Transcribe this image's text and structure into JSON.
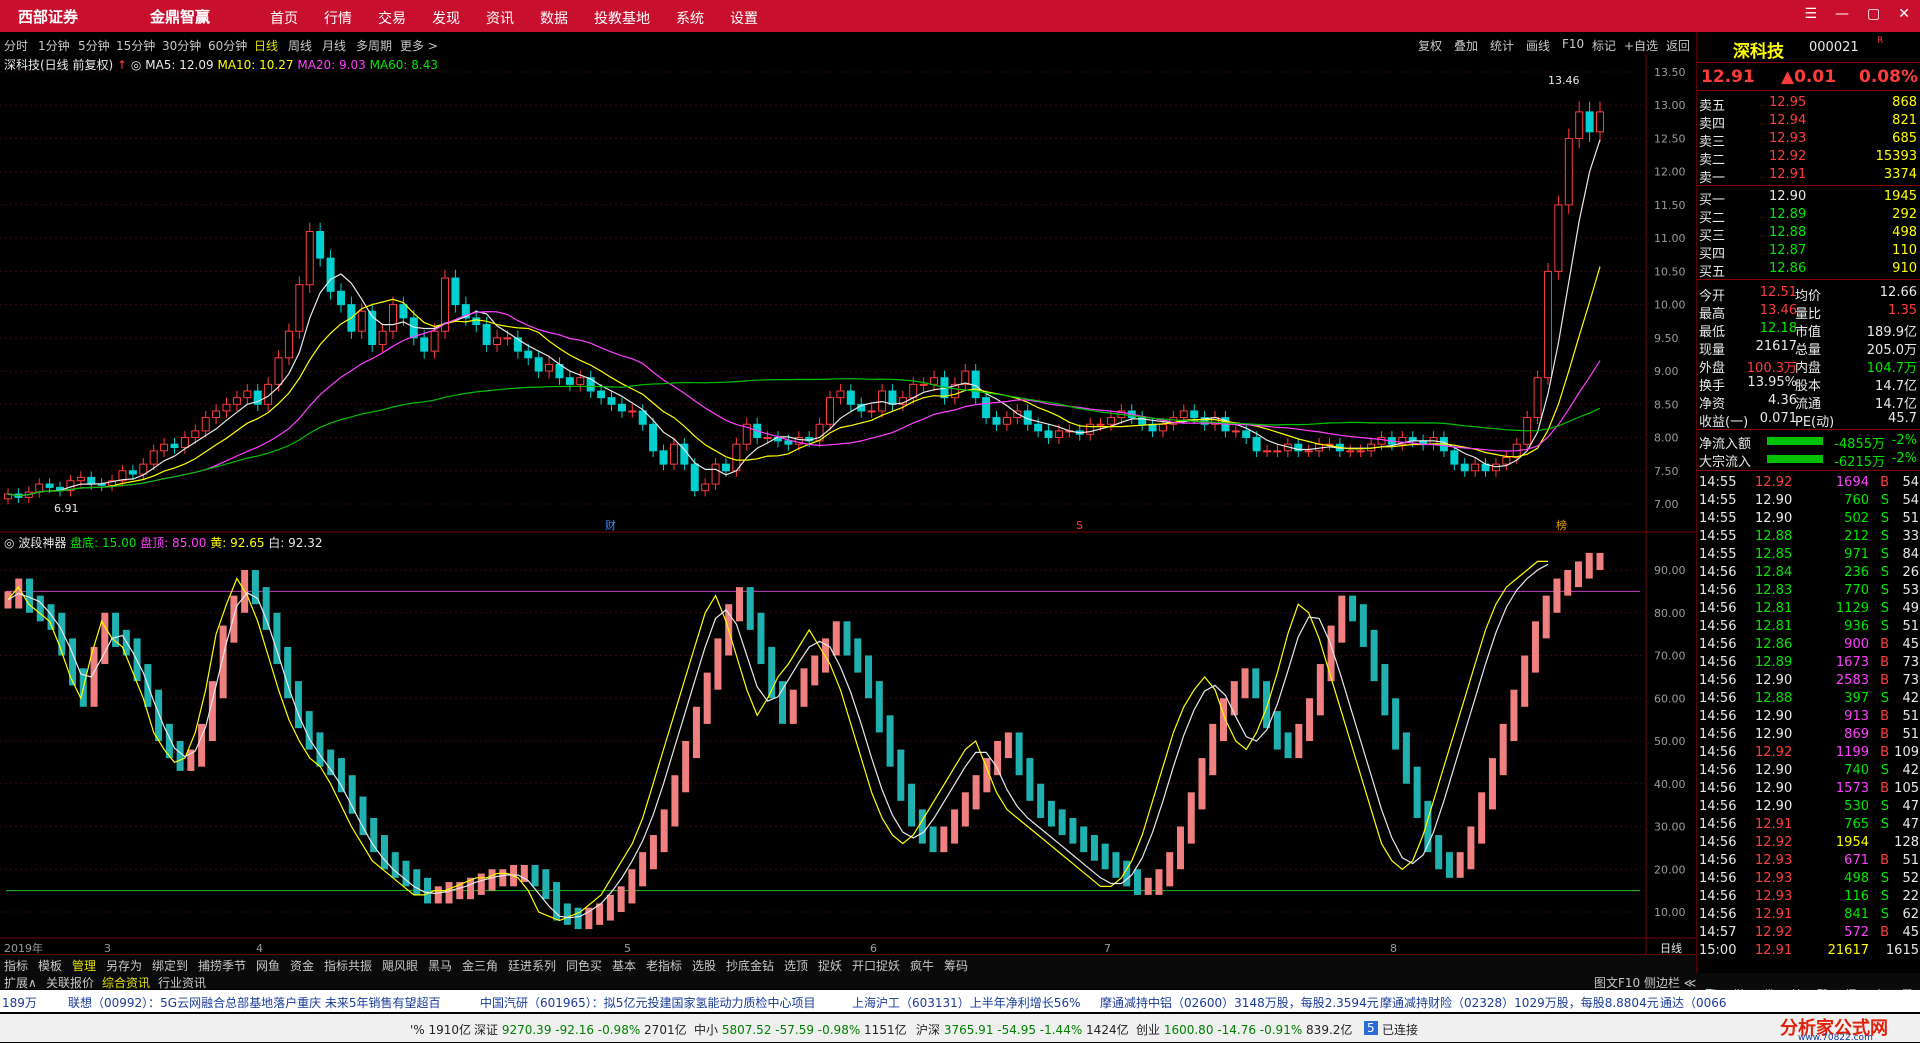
{
  "topbar": {
    "broker": "西部证券",
    "brand": "金鼎智赢",
    "menu": [
      "首页",
      "行情",
      "交易",
      "发现",
      "资讯",
      "数据",
      "投教基地",
      "系统",
      "设置"
    ],
    "window_controls": [
      "☰",
      "—",
      "▢",
      "✕"
    ]
  },
  "periods": {
    "items": [
      "分时",
      "1分钟",
      "5分钟",
      "15分钟",
      "30分钟",
      "60分钟",
      "日线",
      "周线",
      "月线",
      "多周期",
      "更多 >"
    ],
    "active": "日线",
    "right_tools": [
      "复权",
      "叠加",
      "统计",
      "画线",
      "F10",
      "标记",
      "+自选",
      "返回"
    ]
  },
  "main_chart": {
    "stock_label": "深科技(日线 前复权)",
    "ma5": "MA5: 12.09",
    "ma10": "MA10: 10.27",
    "ma20": "MA20: 9.03",
    "ma60": "MA60: 8.43",
    "max_label": "13.46",
    "min_label": "6.91",
    "markers": [
      "财",
      "S",
      "榜"
    ]
  },
  "indicator": {
    "name": "波段神器",
    "bottom": "盘底: 15.00",
    "top": "盘顶: 85.00",
    "yellow": "黄: 92.65",
    "white": "白: 92.32"
  },
  "chart_data": {
    "type": "candlestick",
    "price_axis_ticks": [
      "13.50",
      "13.00",
      "12.50",
      "12.00",
      "11.50",
      "11.00",
      "10.50",
      "10.00",
      "9.50",
      "9.00",
      "8.50",
      "8.00",
      "7.50",
      "7.00"
    ],
    "indicator_axis_ticks": [
      "90.00",
      "80.00",
      "70.00",
      "60.00",
      "50.00",
      "40.00",
      "30.00",
      "20.00",
      "10.00"
    ],
    "time_labels": [
      "2019年",
      "3",
      "4",
      "5",
      "6",
      "7",
      "8"
    ],
    "period_label": "日线",
    "closes": [
      7.15,
      7.1,
      7.18,
      7.3,
      7.25,
      7.2,
      7.35,
      7.4,
      7.3,
      7.28,
      7.35,
      7.5,
      7.45,
      7.6,
      7.8,
      7.9,
      7.85,
      8.0,
      8.1,
      8.3,
      8.4,
      8.5,
      8.6,
      8.7,
      8.5,
      8.8,
      9.2,
      9.6,
      10.3,
      11.1,
      10.7,
      10.2,
      10.0,
      9.6,
      9.9,
      9.4,
      9.6,
      10.0,
      9.8,
      9.5,
      9.3,
      9.6,
      10.4,
      10.0,
      9.8,
      9.7,
      9.4,
      9.5,
      9.5,
      9.3,
      9.2,
      9.0,
      9.1,
      8.9,
      8.8,
      8.9,
      8.7,
      8.6,
      8.5,
      8.4,
      8.4,
      8.2,
      7.8,
      7.6,
      7.9,
      7.6,
      7.2,
      7.3,
      7.6,
      7.5,
      7.9,
      8.2,
      8.0,
      8.0,
      7.95,
      7.9,
      8.0,
      7.95,
      8.2,
      8.6,
      8.7,
      8.5,
      8.4,
      8.4,
      8.7,
      8.5,
      8.6,
      8.8,
      8.8,
      8.9,
      8.6,
      8.8,
      9.0,
      8.6,
      8.3,
      8.2,
      8.3,
      8.4,
      8.2,
      8.1,
      8.0,
      8.1,
      8.1,
      8.05,
      8.2,
      8.2,
      8.3,
      8.4,
      8.3,
      8.2,
      8.1,
      8.2,
      8.3,
      8.4,
      8.3,
      8.2,
      8.3,
      8.1,
      8.1,
      8.0,
      7.8,
      7.8,
      7.8,
      7.9,
      7.8,
      7.8,
      7.9,
      7.9,
      7.8,
      7.8,
      7.8,
      7.9,
      8.0,
      7.9,
      8.0,
      7.95,
      7.9,
      8.0,
      7.8,
      7.6,
      7.5,
      7.6,
      7.5,
      7.6,
      7.7,
      7.9,
      8.3,
      8.9,
      10.5,
      11.5,
      12.5,
      12.9,
      12.6,
      12.9
    ],
    "indicator_values": [
      83,
      86,
      82,
      80,
      78,
      72,
      65,
      60,
      70,
      78,
      74,
      72,
      66,
      60,
      52,
      48,
      45,
      46,
      52,
      62,
      75,
      82,
      88,
      84,
      78,
      70,
      62,
      55,
      50,
      46,
      44,
      40,
      35,
      30,
      26,
      22,
      20,
      18,
      16,
      14,
      14,
      15,
      15,
      16,
      17,
      18,
      18,
      19,
      19,
      18,
      15,
      10,
      9,
      8,
      9,
      10,
      12,
      14,
      18,
      22,
      26,
      32,
      40,
      48,
      56,
      64,
      72,
      80,
      84,
      78,
      70,
      62,
      56,
      60,
      65,
      68,
      72,
      76,
      72,
      68,
      62,
      54,
      46,
      38,
      32,
      28,
      26,
      28,
      32,
      36,
      40,
      44,
      48,
      50,
      44,
      38,
      34,
      32,
      30,
      28,
      26,
      24,
      22,
      20,
      18,
      16,
      16,
      18,
      22,
      28,
      36,
      44,
      52,
      58,
      62,
      65,
      62,
      55,
      50,
      48,
      52,
      58,
      66,
      75,
      82,
      80,
      74,
      66,
      58,
      50,
      42,
      34,
      26,
      22,
      20,
      22,
      28,
      36,
      44,
      52,
      60,
      68,
      76,
      82,
      86,
      88,
      90,
      92,
      92
    ]
  },
  "quote": {
    "name": "深科技",
    "code": "000021",
    "rz": "R",
    "price": "12.91",
    "change": "▲0.01",
    "pct": "0.08%",
    "asks": [
      [
        "卖五",
        "12.95",
        "868"
      ],
      [
        "卖四",
        "12.94",
        "821"
      ],
      [
        "卖三",
        "12.93",
        "685"
      ],
      [
        "卖二",
        "12.92",
        "15393"
      ],
      [
        "卖一",
        "12.91",
        "3374"
      ]
    ],
    "bids": [
      [
        "买一",
        "12.90",
        "1945"
      ],
      [
        "买二",
        "12.89",
        "292"
      ],
      [
        "买三",
        "12.88",
        "498"
      ],
      [
        "买四",
        "12.87",
        "110"
      ],
      [
        "买五",
        "12.86",
        "910"
      ]
    ],
    "stats": [
      [
        "今开",
        "12.51",
        "均价",
        "12.66"
      ],
      [
        "最高",
        "13.46",
        "量比",
        "1.35"
      ],
      [
        "最低",
        "12.18",
        "市值",
        "189.9亿"
      ],
      [
        "现量",
        "21617",
        "总量",
        "205.0万"
      ],
      [
        "外盘",
        "100.3万",
        "内盘",
        "104.7万"
      ],
      [
        "换手",
        "13.95%",
        "股本",
        "14.7亿"
      ],
      [
        "净资",
        "4.36",
        "流通",
        "14.7亿"
      ],
      [
        "收益(一)",
        "0.071",
        "PE(动)",
        "45.7"
      ]
    ],
    "flows": [
      [
        "净流入额",
        "-4855万",
        "-2%"
      ],
      [
        "大宗流入",
        "-6215万",
        "-2%"
      ]
    ],
    "ticks": [
      [
        "14:55",
        "12.92",
        "1694",
        "B",
        "54"
      ],
      [
        "14:55",
        "12.90",
        "760",
        "S",
        "54"
      ],
      [
        "14:55",
        "12.90",
        "502",
        "S",
        "51"
      ],
      [
        "14:55",
        "12.88",
        "212",
        "S",
        "33"
      ],
      [
        "14:55",
        "12.85",
        "971",
        "S",
        "84"
      ],
      [
        "14:56",
        "12.84",
        "236",
        "S",
        "26"
      ],
      [
        "14:56",
        "12.83",
        "770",
        "S",
        "53"
      ],
      [
        "14:56",
        "12.81",
        "1129",
        "S",
        "49"
      ],
      [
        "14:56",
        "12.81",
        "936",
        "S",
        "51"
      ],
      [
        "14:56",
        "12.86",
        "900",
        "B",
        "45"
      ],
      [
        "14:56",
        "12.89",
        "1673",
        "B",
        "73"
      ],
      [
        "14:56",
        "12.90",
        "2583",
        "B",
        "73"
      ],
      [
        "14:56",
        "12.88",
        "397",
        "S",
        "42"
      ],
      [
        "14:56",
        "12.90",
        "913",
        "B",
        "51"
      ],
      [
        "14:56",
        "12.90",
        "869",
        "B",
        "51"
      ],
      [
        "14:56",
        "12.92",
        "1199",
        "B",
        "109"
      ],
      [
        "14:56",
        "12.90",
        "740",
        "S",
        "42"
      ],
      [
        "14:56",
        "12.90",
        "1573",
        "B",
        "105"
      ],
      [
        "14:56",
        "12.90",
        "530",
        "S",
        "47"
      ],
      [
        "14:56",
        "12.91",
        "765",
        "S",
        "47"
      ],
      [
        "14:56",
        "12.92",
        "1954",
        "",
        "128"
      ],
      [
        "14:56",
        "12.93",
        "671",
        "B",
        "51"
      ],
      [
        "14:56",
        "12.93",
        "498",
        "S",
        "52"
      ],
      [
        "14:56",
        "12.93",
        "116",
        "S",
        "22"
      ],
      [
        "14:56",
        "12.91",
        "841",
        "S",
        "62"
      ],
      [
        "14:57",
        "12.92",
        "572",
        "B",
        "45"
      ],
      [
        "15:00",
        "12.91",
        "21617",
        "",
        "1615"
      ]
    ],
    "side_tabs": [
      "笔",
      "价",
      "细",
      "势",
      "联",
      "值",
      "主",
      "筹"
    ]
  },
  "bottom_tabs": [
    "指标",
    "模板",
    "管理",
    "另存为",
    "绑定到",
    "捕捞季节",
    "网鱼",
    "资金",
    "指标共振",
    "飓风眼",
    "黑马",
    "金三角",
    "廷进系列",
    "同色买",
    "基本",
    "老指标",
    "选股",
    "抄底金钻",
    "选顶",
    "捉妖",
    "开口捉妖",
    "疯牛",
    "筹码"
  ],
  "bottom_tabs_active": "管理",
  "sub_tabs": [
    "扩展∧",
    "关联报价",
    "综合资讯",
    "行业资讯"
  ],
  "f10_bar": "图文F10 侧边栏 ≪",
  "ticker": [
    "189万",
    "联想（00992）：5G云网融合总部基地落户重庆 未来5年销售有望超百",
    "中国汽研（601965）：拟5亿元投建国家氢能动力质检中心项目",
    "上海沪工（603131）上半年净利增长56%",
    "摩通减持中铝（02600）3148万股，每股2.3594元",
    "摩通减持财险（02328）1029万股，每股8.8804元",
    "通达（0066"
  ],
  "statusbar": {
    "prefix": "'% 1910亿",
    "indices": [
      [
        "深证",
        "9270.39",
        "-92.16",
        "-0.98%",
        "2701亿"
      ],
      [
        "中小",
        "5807.52",
        "-57.59",
        "-0.98%",
        "1151亿"
      ],
      [
        "沪深",
        "3765.91",
        "-54.95",
        "-1.44%",
        "1424亿"
      ],
      [
        "创业",
        "1600.80",
        "-14.76",
        "-0.91%",
        "839.2亿"
      ]
    ],
    "connection": "已连接",
    "watermark": "分析家公式网",
    "watermark_url": "www.70822.com"
  }
}
